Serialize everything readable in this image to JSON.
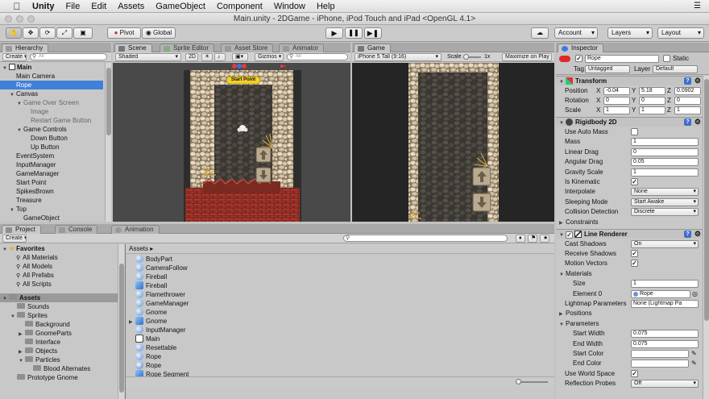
{
  "menubar": {
    "items": [
      "Unity",
      "File",
      "Edit",
      "Assets",
      "GameObject",
      "Component",
      "Window",
      "Help"
    ]
  },
  "window": {
    "title": "Main.unity - 2DGame - iPhone, iPod Touch and iPad <OpenGL 4.1>"
  },
  "toolbar": {
    "pivot_label": "Pivot",
    "global_label": "Global",
    "account_label": "Account",
    "layers_label": "Layers",
    "layout_label": "Layout"
  },
  "hierarchy": {
    "tab_label": "Hierarchy",
    "create_label": "Create",
    "search_placeholder": "All",
    "items": [
      {
        "label": "Main",
        "indent": 0,
        "arrow": "▼",
        "kind": "scene"
      },
      {
        "label": "Main Camera",
        "indent": 1,
        "arrow": ""
      },
      {
        "label": "Rope",
        "indent": 1,
        "arrow": "",
        "selected": true
      },
      {
        "label": "Canvas",
        "indent": 1,
        "arrow": "▼"
      },
      {
        "label": "Game Over Screen",
        "indent": 2,
        "arrow": "▼",
        "dim": true
      },
      {
        "label": "Image",
        "indent": 3,
        "arrow": "",
        "dim": true
      },
      {
        "label": "Restart Game Button",
        "indent": 3,
        "arrow": "",
        "dim": true
      },
      {
        "label": "Game Controls",
        "indent": 2,
        "arrow": "▼"
      },
      {
        "label": "Down Button",
        "indent": 3,
        "arrow": ""
      },
      {
        "label": "Up Button",
        "indent": 3,
        "arrow": ""
      },
      {
        "label": "EventSystem",
        "indent": 1,
        "arrow": ""
      },
      {
        "label": "InputManager",
        "indent": 1,
        "arrow": ""
      },
      {
        "label": "GameManager",
        "indent": 1,
        "arrow": ""
      },
      {
        "label": "Start Point",
        "indent": 1,
        "arrow": ""
      },
      {
        "label": "SpikesBrown",
        "indent": 1,
        "arrow": ""
      },
      {
        "label": "Treasure",
        "indent": 1,
        "arrow": ""
      },
      {
        "label": "Top",
        "indent": 1,
        "arrow": "▼"
      },
      {
        "label": "GameObject",
        "indent": 2,
        "arrow": ""
      }
    ]
  },
  "scene": {
    "tabs": [
      "Scene",
      "Sprite Editor",
      "Asset Store",
      "Animator"
    ],
    "shading_label": "Shaded",
    "mode_2d_label": "2D",
    "gizmos_label": "Gizmos",
    "search_placeholder": "All",
    "start_point_label": "Start Point"
  },
  "game": {
    "tab_label": "Game",
    "resolution_label": "iPhone 5 Tall (9:16)",
    "scale_label": "Scale",
    "scale_value": "1x",
    "maximize_label": "Maximize on Play"
  },
  "inspector": {
    "tab_label": "Inspector",
    "object_name": "Rope",
    "static_label": "Static",
    "tag_label": "Tag",
    "tag_value": "Untagged",
    "layer_label": "Layer",
    "layer_value": "Default",
    "transform": {
      "title": "Transform",
      "position_label": "Position",
      "rotation_label": "Rotation",
      "scale_label": "Scale",
      "position": {
        "x": "-0.04",
        "y": "5.18",
        "z": "0.0902"
      },
      "rotation": {
        "x": "0",
        "y": "0",
        "z": "0"
      },
      "scale": {
        "x": "1",
        "y": "1",
        "z": "1"
      }
    },
    "rigidbody": {
      "title": "Rigidbody 2D",
      "props": [
        {
          "label": "Use Auto Mass",
          "type": "check",
          "value": ""
        },
        {
          "label": "Mass",
          "type": "field",
          "value": "1"
        },
        {
          "label": "Linear Drag",
          "type": "field",
          "value": "0"
        },
        {
          "label": "Angular Drag",
          "type": "field",
          "value": "0.05"
        },
        {
          "label": "Gravity Scale",
          "type": "field",
          "value": "1"
        },
        {
          "label": "Is Kinematic",
          "type": "check",
          "value": "✓"
        },
        {
          "label": "Interpolate",
          "type": "drop",
          "value": "None"
        },
        {
          "label": "Sleeping Mode",
          "type": "drop",
          "value": "Start Awake"
        },
        {
          "label": "Collision Detection",
          "type": "drop",
          "value": "Discrete"
        }
      ],
      "constraints_label": "Constraints"
    },
    "line_renderer": {
      "title": "Line Renderer",
      "props": [
        {
          "label": "Cast Shadows",
          "type": "drop",
          "value": "On",
          "indent": 0
        },
        {
          "label": "Receive Shadows",
          "type": "check",
          "value": "✓",
          "indent": 0
        },
        {
          "label": "Motion Vectors",
          "type": "check",
          "value": "✓",
          "indent": 0
        },
        {
          "label": "Materials",
          "type": "fold",
          "value": "",
          "indent": 0
        },
        {
          "label": "Size",
          "type": "field",
          "value": "1",
          "indent": 2
        },
        {
          "label": "Element 0",
          "type": "obj",
          "value": "Rope",
          "indent": 2
        },
        {
          "label": "Lightmap Parameters",
          "type": "field",
          "value": "None (Lightmap Pa",
          "indent": 0
        },
        {
          "label": "Positions",
          "type": "fold",
          "value": "",
          "indent": 0
        },
        {
          "label": "Parameters",
          "type": "fold",
          "value": "",
          "indent": 0
        },
        {
          "label": "Start Width",
          "type": "field",
          "value": "0.075",
          "indent": 2
        },
        {
          "label": "End Width",
          "type": "field",
          "value": "0.075",
          "indent": 2
        },
        {
          "label": "Start Color",
          "type": "color",
          "value": "",
          "indent": 2
        },
        {
          "label": "End Color",
          "type": "color",
          "value": "",
          "indent": 2
        },
        {
          "label": "Use World Space",
          "type": "check",
          "value": "✓",
          "indent": 0
        },
        {
          "label": "Reflection Probes",
          "type": "drop",
          "value": "Off",
          "indent": 0
        }
      ]
    }
  },
  "project": {
    "tabs": [
      "Project",
      "Console",
      "Animation"
    ],
    "create_label": "Create",
    "favorites_label": "Favorites",
    "favorites": [
      "All Materials",
      "All Models",
      "All Prefabs",
      "All Scripts"
    ],
    "assets_label": "Assets",
    "asset_folders": [
      {
        "label": "Sounds",
        "indent": 1,
        "arrow": ""
      },
      {
        "label": "Sprites",
        "indent": 1,
        "arrow": "▼"
      },
      {
        "label": "Background",
        "indent": 2,
        "arrow": ""
      },
      {
        "label": "GnomeParts",
        "indent": 2,
        "arrow": "▶"
      },
      {
        "label": "Interface",
        "indent": 2,
        "arrow": ""
      },
      {
        "label": "Objects",
        "indent": 2,
        "arrow": "▶"
      },
      {
        "label": "Particles",
        "indent": 2,
        "arrow": "▼"
      },
      {
        "label": "Blood Alternates",
        "indent": 3,
        "arrow": ""
      },
      {
        "label": "Prototype Gnome",
        "indent": 1,
        "arrow": ""
      }
    ],
    "breadcrumb": "Assets",
    "files": [
      {
        "label": "BodyPart",
        "kind": "script",
        "arrow": ""
      },
      {
        "label": "CameraFollow",
        "kind": "script",
        "arrow": ""
      },
      {
        "label": "Fireball",
        "kind": "script",
        "arrow": ""
      },
      {
        "label": "Fireball",
        "kind": "prefab",
        "arrow": ""
      },
      {
        "label": "Flamethrower",
        "kind": "script",
        "arrow": ""
      },
      {
        "label": "GameManager",
        "kind": "script",
        "arrow": ""
      },
      {
        "label": "Gnome",
        "kind": "script",
        "arrow": ""
      },
      {
        "label": "Gnome",
        "kind": "prefab",
        "arrow": "▶"
      },
      {
        "label": "InputManager",
        "kind": "script",
        "arrow": ""
      },
      {
        "label": "Main",
        "kind": "scene",
        "arrow": ""
      },
      {
        "label": "Resettable",
        "kind": "script",
        "arrow": ""
      },
      {
        "label": "Rope",
        "kind": "script",
        "arrow": ""
      },
      {
        "label": "Rope",
        "kind": "sprite",
        "arrow": ""
      },
      {
        "label": "Rope Segment",
        "kind": "prefab",
        "arrow": ""
      }
    ]
  },
  "colors": {
    "selection": "#3f80d9",
    "panel_bg": "#c8c8c8",
    "viewport_bg": "#494949"
  }
}
